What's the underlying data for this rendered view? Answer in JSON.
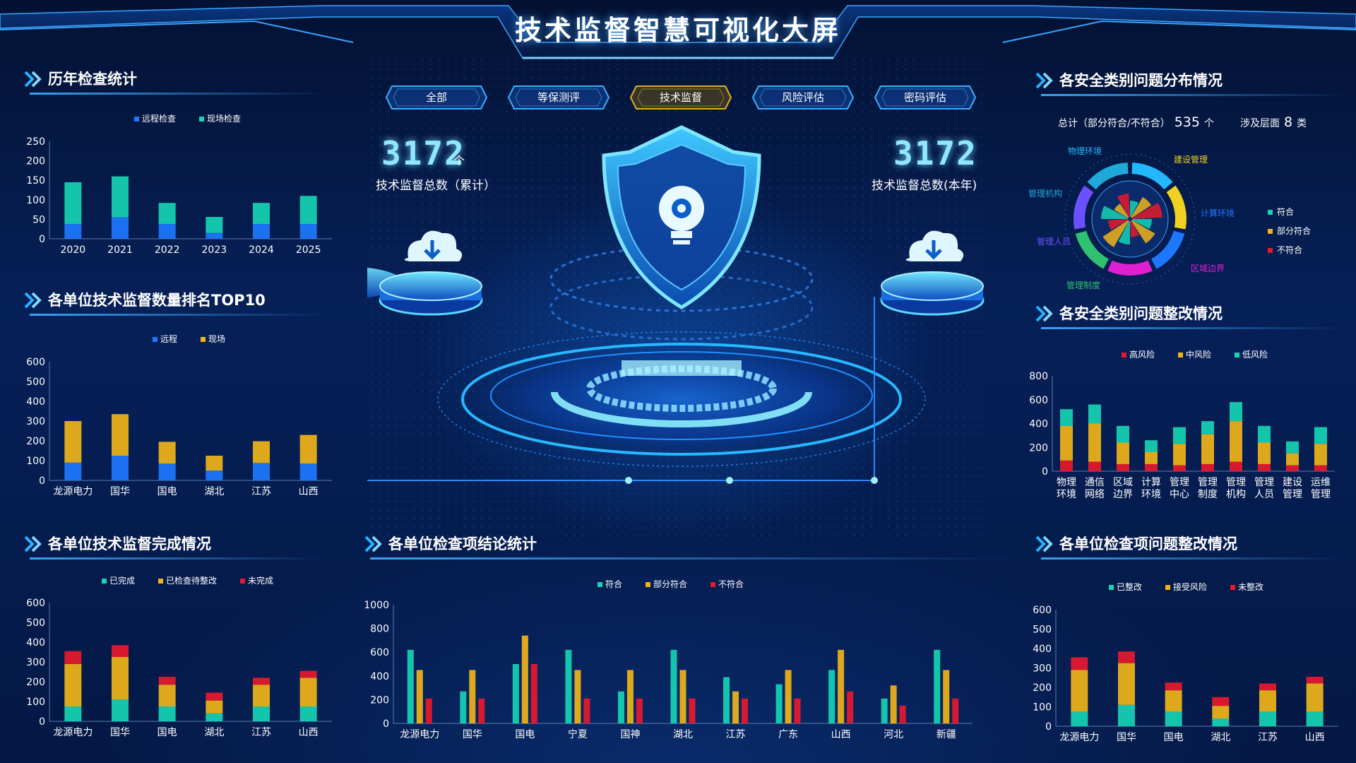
{
  "title": "技术监督智慧可视化大屏",
  "colors": {
    "teal": "#16d4b4",
    "blue": "#1e78ff",
    "yellow": "#f0b418",
    "red": "#e8192c",
    "accent": "#39b0ff",
    "tab_active": "#e0b020"
  },
  "tabs": [
    {
      "label": "全部",
      "active": false
    },
    {
      "label": "等保测评",
      "active": false
    },
    {
      "label": "技术监督",
      "active": true
    },
    {
      "label": "风险评估",
      "active": false
    },
    {
      "label": "密码评估",
      "active": false
    }
  ],
  "center": {
    "left_count": "3172",
    "left_unit": "个",
    "left_label": "技术监督总数（累计）",
    "right_count": "3172",
    "right_label": "技术监督总数(本年)",
    "shield_icon": "gear-lightbulb-icon",
    "cloud_icon": "cloud-download-icon"
  },
  "panels": {
    "yearly": {
      "title": "历年检查统计",
      "chart": {
        "type": "bar",
        "stacked": true,
        "categories": [
          "2020",
          "2021",
          "2022",
          "2023",
          "2024",
          "2025"
        ],
        "y_ticks": [
          "250",
          "200",
          "150",
          "100",
          "50",
          "0"
        ],
        "ylim": [
          0,
          250
        ],
        "series": [
          {
            "name": "远程检查",
            "color": "#1e78ff",
            "values": [
              38,
              55,
              38,
              15,
              38,
              38
            ]
          },
          {
            "name": "现场检查",
            "color": "#16d4b4",
            "values": [
              107,
              105,
              54,
              41,
              54,
              72
            ]
          }
        ]
      }
    },
    "ranking": {
      "title": "各单位技术监督数量排名TOP10",
      "chart": {
        "type": "bar",
        "stacked": true,
        "categories": [
          "龙源电力",
          "国华",
          "国电",
          "湖北",
          "江苏",
          "山西"
        ],
        "y_ticks": [
          "600",
          "500",
          "400",
          "300",
          "200",
          "100",
          "0"
        ],
        "ylim": [
          0,
          600
        ],
        "series": [
          {
            "name": "远程",
            "color": "#1e78ff",
            "values": [
              90,
              125,
              85,
              50,
              88,
              85
            ]
          },
          {
            "name": "现场",
            "color": "#f0b418",
            "values": [
              210,
              210,
              110,
              75,
              110,
              145
            ]
          }
        ]
      }
    },
    "completion": {
      "title": "各单位技术监督完成情况",
      "chart": {
        "type": "bar",
        "stacked": true,
        "categories": [
          "龙源电力",
          "国华",
          "国电",
          "湖北",
          "江苏",
          "山西"
        ],
        "y_ticks": [
          "600",
          "500",
          "400",
          "300",
          "200",
          "100",
          "0"
        ],
        "ylim": [
          0,
          600
        ],
        "series": [
          {
            "name": "已完成",
            "color": "#16d4b4",
            "values": [
              75,
              110,
              75,
              40,
              75,
              75
            ]
          },
          {
            "name": "已检查待整改",
            "color": "#f0b418",
            "values": [
              215,
              215,
              110,
              65,
              110,
              145
            ]
          },
          {
            "name": "未完成",
            "color": "#e8192c",
            "values": [
              65,
              60,
              40,
              40,
              35,
              35
            ]
          }
        ]
      }
    },
    "conclusion": {
      "title": "各单位检查项结论统计",
      "chart": {
        "type": "bar",
        "grouped": true,
        "categories": [
          "龙源电力",
          "国华",
          "国电",
          "宁夏",
          "国神",
          "湖北",
          "江苏",
          "广东",
          "山西",
          "河北",
          "新疆"
        ],
        "y_ticks": [
          "1000",
          "800",
          "600",
          "400",
          "200",
          "0"
        ],
        "ylim": [
          0,
          1000
        ],
        "series": [
          {
            "name": "符合",
            "color": "#16d4b4",
            "values": [
              620,
              270,
              500,
              620,
              270,
              620,
              390,
              330,
              450,
              210,
              620
            ]
          },
          {
            "name": "部分符合",
            "color": "#f0b418",
            "values": [
              450,
              450,
              740,
              450,
              450,
              450,
              270,
              450,
              620,
              320,
              450
            ]
          },
          {
            "name": "不符合",
            "color": "#e8192c",
            "values": [
              210,
              210,
              500,
              210,
              210,
              210,
              210,
              210,
              270,
              150,
              210
            ]
          }
        ]
      }
    },
    "distribution": {
      "title": "各安全类别问题分布情况",
      "total_label": "总计（部分符合/不符合）",
      "total_value": "535",
      "total_unit": "个",
      "layers_label": "涉及层面",
      "layers_value": "8",
      "layers_unit": "类",
      "categories": [
        "物理环境",
        "建设管理",
        "计算环境",
        "区域边界",
        "管理制度",
        "管理人员",
        "管理机构"
      ],
      "ring_colors": [
        "#23b7ff",
        "#f0d020",
        "#1e78ff",
        "#e020d0",
        "#30c070",
        "#6a50ff",
        "#1fa8d8"
      ],
      "legend": [
        {
          "name": "符合",
          "color": "#16d4b4"
        },
        {
          "name": "部分符合",
          "color": "#f0b418"
        },
        {
          "name": "不符合",
          "color": "#e8192c"
        }
      ]
    },
    "rectification": {
      "title": "各安全类别问题整改情况",
      "chart": {
        "type": "bar",
        "stacked": true,
        "categories": [
          [
            "物理",
            "环境"
          ],
          [
            "通信",
            "网络"
          ],
          [
            "区域",
            "边界"
          ],
          [
            "计算",
            "环境"
          ],
          [
            "管理",
            "中心"
          ],
          [
            "管理",
            "制度"
          ],
          [
            "管理",
            "机构"
          ],
          [
            "管理",
            "人员"
          ],
          [
            "建设",
            "管理"
          ],
          [
            "运维",
            "管理"
          ]
        ],
        "y_ticks": [
          "800",
          "600",
          "400",
          "200",
          "0"
        ],
        "ylim": [
          0,
          800
        ],
        "series": [
          {
            "name": "高风险",
            "color": "#e8192c",
            "values": [
              90,
              80,
              60,
              60,
              50,
              60,
              80,
              60,
              50,
              50
            ]
          },
          {
            "name": "中风险",
            "color": "#f0b418",
            "values": [
              290,
              320,
              180,
              100,
              180,
              250,
              340,
              180,
              100,
              180
            ]
          },
          {
            "name": "低风险",
            "color": "#16d4b4",
            "values": [
              140,
              160,
              140,
              100,
              140,
              110,
              160,
              140,
              100,
              140
            ]
          }
        ]
      }
    },
    "unit_rectification": {
      "title": "各单位检查项问题整改情况",
      "chart": {
        "type": "bar",
        "stacked": true,
        "categories": [
          "龙源电力",
          "国华",
          "国电",
          "湖北",
          "江苏",
          "山西"
        ],
        "y_ticks": [
          "600",
          "500",
          "400",
          "300",
          "200",
          "100",
          "0"
        ],
        "ylim": [
          0,
          600
        ],
        "series": [
          {
            "name": "已整改",
            "color": "#16d4b4",
            "values": [
              75,
              110,
              75,
              40,
              75,
              75
            ]
          },
          {
            "name": "接受风险",
            "color": "#f0b418",
            "values": [
              215,
              215,
              110,
              65,
              110,
              145
            ]
          },
          {
            "name": "未整改",
            "color": "#e8192c",
            "values": [
              65,
              60,
              40,
              45,
              35,
              35
            ]
          }
        ]
      }
    }
  }
}
